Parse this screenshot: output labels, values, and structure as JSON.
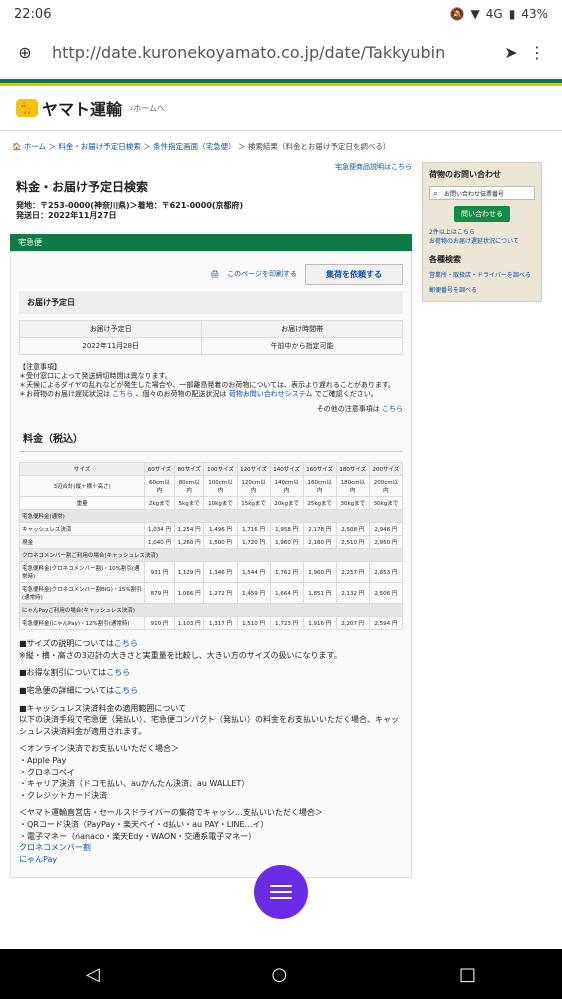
{
  "status": {
    "time": "22:06",
    "battery": "43%",
    "network": "4G"
  },
  "browser": {
    "url": "http://date.kuronekoyamato.co.jp/date/Takkyubin"
  },
  "header": {
    "logo": "ヤマト運輸",
    "home": "›ホームへ"
  },
  "breadcrumb": {
    "home": "ホーム",
    "step1": "料金・お届け予定日検索",
    "step2": "条件指定画面（宅急便）",
    "current": "検索結果（料金とお届け予定日を調べる）",
    "sep": "＞"
  },
  "main": {
    "product_link": "宅急便商品説明はこちら",
    "title": "料金・お届け予定日検索",
    "meta1": "発地：〒253-0000(神奈川県)＞着地：〒621-0000(京都府)",
    "meta2": "発送日：2022年11月27日",
    "service": "宅急便",
    "print": "このページを印刷する",
    "request": "集荷を依頼する",
    "delivery_title": "お届け予定日",
    "delivery_table": {
      "head_date": "お届け予定日",
      "head_time": "お届け時間帯",
      "date": "2022年11月28日",
      "time": "午前中から指定可能"
    },
    "notes": {
      "head": "【注意事項】",
      "n1": "＊受付窓口によって発送締切時間は異なります。",
      "n2": "＊天候によるダイヤの乱れなどが発生した場合や、一部離島発着のお荷物については、表示より遅れることがあります。",
      "n3a": "＊お荷物のお届け遅延状況は",
      "n3b": "こちら",
      "n3c": "、個々のお荷物の配送状況は",
      "n3d": "荷物お問い合わせシステム",
      "n3e": "でご確認ください。",
      "other": "その他の注意事項は",
      "other_link": "こちら"
    },
    "fee_title": "料金（税込）",
    "after": {
      "s1": "■サイズの説明については",
      "s1_link": "こちら",
      "s1b": "※縦・横・高さの3辺計の大きさと実重量を比較し、大きい方のサイズの扱いになります。",
      "s2": "■お得な割引については",
      "s2_link": "こちら",
      "s3": "■宅急便の詳細については",
      "s3_link": "こちら",
      "s4": "■キャッシュレス決済料金の適用範囲について",
      "s4b": "以下の決済手段で宅急便（発払い）、宅急便コンパクト（発払い）の料金をお支払いいただく場合、キャッシュレス決済料金が適用されます。",
      "online": "＜オンライン決済でお支払いいただく場合＞",
      "o1": "・Apple Pay",
      "o2": "・クロネコペイ",
      "o3": "・キャリア決済（ドコモ払い、auかんたん決済、au WALLET）",
      "o4": "・クレジットカード決済",
      "store": "＜ヤマト運輸直営店・セールスドライバーの集荷でキャッシ…支払いいただく場合＞",
      "st1": "・QRコード決済（PayPay・楽天ペイ・d払い・au PAY・LINE…イ）",
      "st2": "・電子マネー（nanaco・楽天Edy・WAON・交通系電子マネー）",
      "st3": "クロネコメンバー割",
      "st4": "にゃんPay"
    }
  },
  "fee_table": {
    "labels": {
      "size": "サイズ",
      "dim": "3辺合計(縦＋横＋高さ)",
      "weight": "重量",
      "basic": "宅急便料金(通常)",
      "cashless": "キャッシュレス決済",
      "cash": "現金",
      "member_group": "クロネコメンバー割ご利用の場合(キャッシュレス決済)",
      "member": "宅急便料金(クロネコメンバー割)・10%割引(通常時)",
      "member_big": "宅急便料金(クロネコメンバー割BIG)・15%割引(通常時)",
      "nyan_group": "にゃんPayご利用の場合(キャッシュレス決済)",
      "nyan": "宅急便料金(にゃんPay)・12%割引(通常時)"
    },
    "sizes": [
      "60サイズ",
      "80サイズ",
      "100サイズ",
      "120サイズ",
      "140サイズ",
      "160サイズ",
      "180サイズ",
      "200サイズ"
    ],
    "dims": [
      "60cm以内",
      "80cm以内",
      "100cm以内",
      "120cm以内",
      "140cm以内",
      "160cm以内",
      "180cm以内",
      "200cm以内"
    ],
    "weights": [
      "2kgまで",
      "5kgまで",
      "10kgまで",
      "15kgまで",
      "20kgまで",
      "25kgまで",
      "30kgまで",
      "30kgまで"
    ],
    "cashless": [
      "1,034 円",
      "1,254 円",
      "1,496 円",
      "1,716 円",
      "1,958 円",
      "2,178 円",
      "2,508 円",
      "2,948 円"
    ],
    "cash": [
      "1,040 円",
      "1,260 円",
      "1,500 円",
      "1,720 円",
      "1,960 円",
      "2,180 円",
      "2,510 円",
      "2,950 円"
    ],
    "member": [
      "931 円",
      "1,129 円",
      "1,346 円",
      "1,544 円",
      "1,762 円",
      "1,960 円",
      "2,257 円",
      "2,653 円"
    ],
    "member_big": [
      "879 円",
      "1,066 円",
      "1,272 円",
      "1,459 円",
      "1,664 円",
      "1,851 円",
      "2,132 円",
      "2,506 円"
    ],
    "nyan": [
      "910 円",
      "1,103 円",
      "1,317 円",
      "1,510 円",
      "1,723 円",
      "1,916 円",
      "2,207 円",
      "2,594 円"
    ]
  },
  "side": {
    "inquiry_title": "荷物のお問い合わせ",
    "input_placeholder": "お問い合わせ伝票番号",
    "inquiry_button": "問い合わせる",
    "link1": "2件以上はこちら",
    "link2": "お荷物のお届け遅延状況について",
    "search_title": "各種検索",
    "search1": "営業所・取扱店・ドライバーを調べる",
    "search2": "郵便番号を調べる"
  }
}
